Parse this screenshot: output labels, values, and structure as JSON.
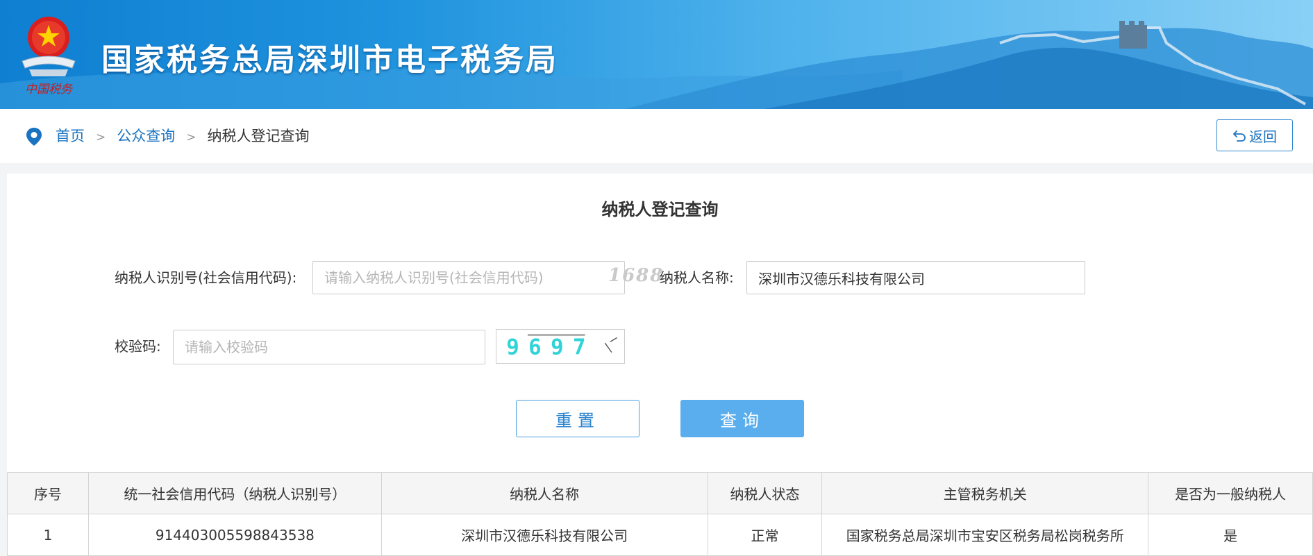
{
  "banner": {
    "title": "国家税务总局深圳市电子税务局",
    "emblem_caption": "中国税务"
  },
  "breadcrumb": {
    "home": "首页",
    "public_query": "公众查询",
    "current": "纳税人登记查询",
    "separator": ">"
  },
  "back_button": {
    "label": "返回"
  },
  "form": {
    "title": "纳税人登记查询",
    "taxpayer_id": {
      "label": "纳税人识别号(社会信用代码):",
      "placeholder": "请输入纳税人识别号(社会信用代码)",
      "value": ""
    },
    "watermark": "1688",
    "taxpayer_name": {
      "label": "纳税人名称:",
      "placeholder": "",
      "value": "深圳市汉德乐科技有限公司"
    },
    "captcha": {
      "label": "校验码:",
      "placeholder": "请输入校验码",
      "value": "",
      "image_text": "9697"
    },
    "reset_label": "重置",
    "query_label": "查询"
  },
  "table": {
    "headers": [
      "序号",
      "统一社会信用代码（纳税人识别号）",
      "纳税人名称",
      "纳税人状态",
      "主管税务机关",
      "是否为一般纳税人"
    ],
    "rows": [
      [
        "1",
        "914403005598843538",
        "深圳市汉德乐科技有限公司",
        "正常",
        "国家税务总局深圳市宝安区税务局松岗税务所",
        "是"
      ]
    ]
  },
  "colors": {
    "banner_blue": "#1f93de",
    "link_blue": "#1a73c0",
    "query_button": "#5aaeed",
    "captcha_text": "#2fd3d8"
  }
}
